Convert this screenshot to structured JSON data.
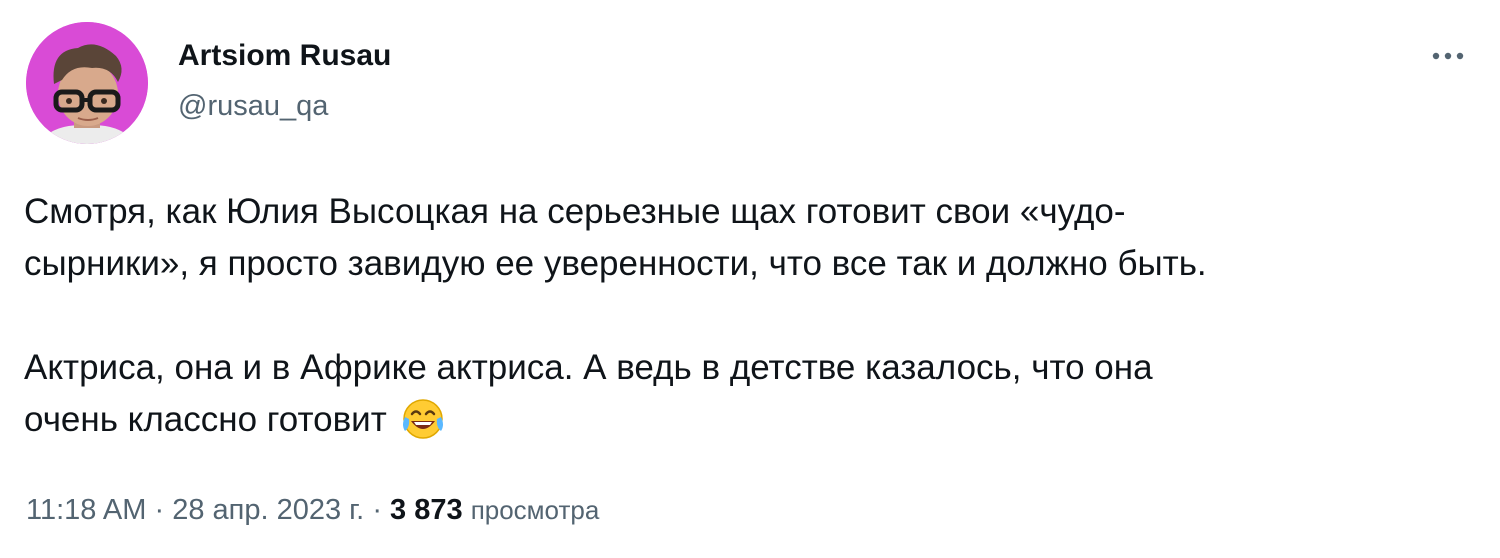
{
  "author": {
    "display_name": "Artsiom Rusau",
    "handle": "@rusau_qa"
  },
  "more_icon": "more-horizontal-icon",
  "tweet": {
    "paragraphs": [
      {
        "lines": [
          "Смотря, как Юлия Высоцкая на серьезные щах готовит свои «чудо-",
          "сырники», я просто завидую ее уверенности, что все так и должно быть."
        ]
      },
      {
        "lines": [
          "Актриса, она и в Африке актриса. А ведь в детстве казалось, что она",
          "очень классно готовит"
        ],
        "emoji": "face-with-tears-of-joy-icon"
      }
    ]
  },
  "meta": {
    "time": "11:18 AM",
    "separator": "·",
    "date": "28 апр. 2023 г.",
    "views_count": "3 873",
    "views_label": "просмотра"
  },
  "colors": {
    "avatar_background": "#d94bd6",
    "text_primary": "#0f1419",
    "text_secondary": "#536471"
  }
}
